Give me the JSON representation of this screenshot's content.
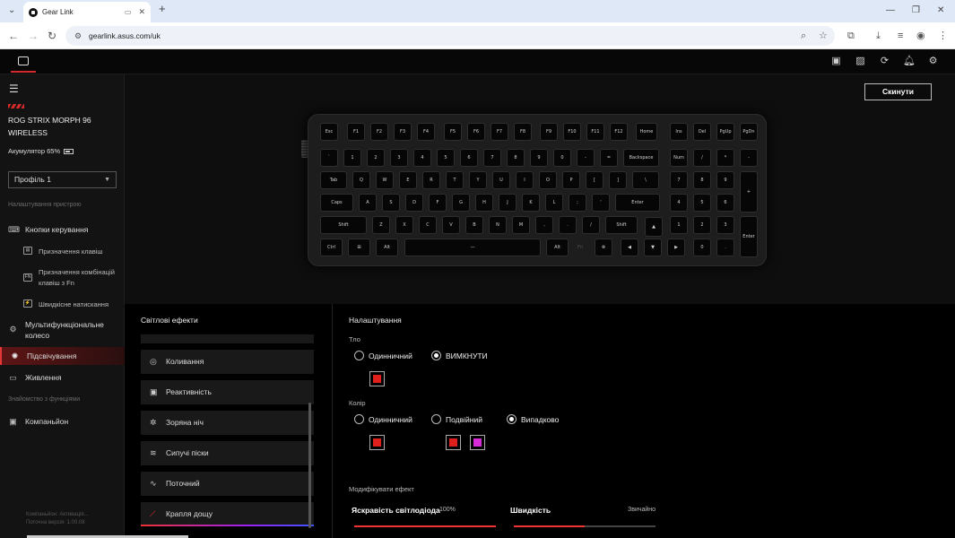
{
  "browser": {
    "tab_title": "Gear Link",
    "url": "gearlink.asus.com/uk"
  },
  "sidebar": {
    "device_name": "ROG STRIX MORPH 96 WIRELESS",
    "battery": "Акумулятор 65%",
    "profile": "Профіль 1",
    "section_device": "Налаштування пристрою",
    "buttons_control": "Кнопки керування",
    "key_assign": "Призначення клавіш",
    "fn_combo": "Призначення комбінацій клавіш з Fn",
    "quick_press": "Швидкісне натискання",
    "wheel": "Мультифункціональне колесо",
    "lighting": "Підсвічування",
    "power": "Живлення",
    "section_features": "Знайомство з функціями",
    "companion": "Компаньйон",
    "footer_companion": "Компаньйон:  Активація...",
    "footer_version": "Поточна версія: 1.00.08"
  },
  "reset_button": "Скинути",
  "keyboard": {
    "rows": [
      [
        "Esc",
        "F1",
        "F2",
        "F3",
        "F4",
        "F5",
        "F6",
        "F7",
        "F8",
        "F9",
        "F10",
        "F11",
        "F12",
        "Home",
        "Ins",
        "Del",
        "PgUp",
        "PgDn"
      ],
      [
        "`",
        "1",
        "2",
        "3",
        "4",
        "5",
        "6",
        "7",
        "8",
        "9",
        "0",
        "-",
        "=",
        "Backspace",
        "Num",
        "/",
        "*",
        "-"
      ],
      [
        "Tab",
        "Q",
        "W",
        "E",
        "R",
        "T",
        "Y",
        "U",
        "I",
        "O",
        "P",
        "[",
        "]",
        "\\",
        "7",
        "8",
        "9",
        "+"
      ],
      [
        "Caps",
        "A",
        "S",
        "D",
        "F",
        "G",
        "H",
        "J",
        "K",
        "L",
        ";",
        "'",
        "Enter",
        "4",
        "5",
        "6"
      ],
      [
        "Shift",
        "Z",
        "X",
        "C",
        "V",
        "B",
        "N",
        "M",
        ",",
        ".",
        "/",
        "Shift",
        "▲",
        "1",
        "2",
        "3",
        "Enter"
      ],
      [
        "Ctrl",
        "⊞",
        "Alt",
        "—",
        "Alt",
        "Fn",
        "⊗",
        "◀",
        "▼",
        "▶",
        "0",
        "."
      ]
    ]
  },
  "effects": {
    "title": "Світлові ефекти",
    "items": [
      {
        "label": "Коливання",
        "icon": "ripple-icon"
      },
      {
        "label": "Реактивність",
        "icon": "reactive-icon"
      },
      {
        "label": "Зоряна ніч",
        "icon": "starry-night-icon"
      },
      {
        "label": "Сипучі піски",
        "icon": "quicksand-icon"
      },
      {
        "label": "Поточний",
        "icon": "current-icon"
      },
      {
        "label": "Крапля дощу",
        "icon": "raindrop-icon"
      }
    ],
    "selected": "Крапля дощу"
  },
  "settings": {
    "title": "Налаштування",
    "background_label": "Тло",
    "bg_single": "Одинничний",
    "bg_off": "ВИМКНУТИ",
    "color_label": "Колір",
    "color_single": "Одинничний",
    "color_double": "Подвійний",
    "color_random": "Випадково",
    "modify_label": "Модифікувати ефект",
    "brightness_label": "Яскравість світлодіода",
    "brightness_value": "100%",
    "speed_label": "Швидкість",
    "speed_value": "Звичайно",
    "brightness_level": 1.0,
    "speed_level": 0.5
  },
  "colors": {
    "accent": "#e23838",
    "swatch_red": "#e0201c",
    "swatch_magenta": "#d62bd6"
  }
}
